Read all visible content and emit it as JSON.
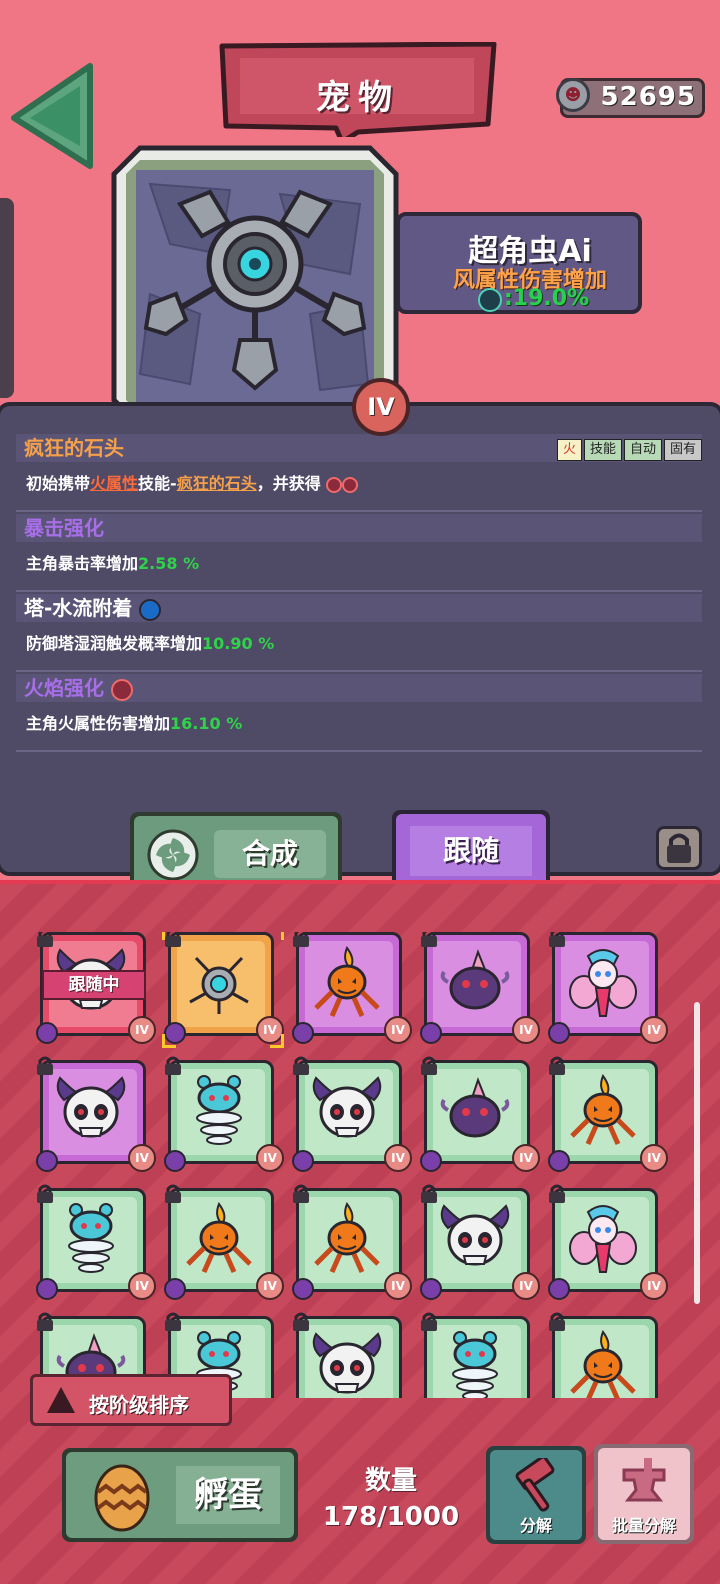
{
  "header": {
    "title": "宠物",
    "currency_value": "52695"
  },
  "pet": {
    "name": "超角虫Ai",
    "attribute": "风属性伤害增加",
    "stat_value": ":19.0%",
    "rank": "IV"
  },
  "skills": [
    {
      "title": "疯狂的石头",
      "title_color": "#f5a04a",
      "tags": [
        "火",
        "技能",
        "自动",
        "固有"
      ],
      "desc_parts": [
        "初始携带",
        "火属性",
        "技能-",
        "疯狂的石头",
        "，并获得"
      ]
    },
    {
      "title": "暴击强化",
      "title_color": "#a86ee8",
      "desc_text": "主角暴击率增加",
      "desc_value": "2.58 %"
    },
    {
      "title": "塔-水流附着",
      "title_color": "#ffffff",
      "desc_text": "防御塔湿润触发概率增加",
      "desc_value": "10.90 %"
    },
    {
      "title": "火焰强化",
      "title_color": "#a86ee8",
      "desc_text": "主角火属性伤害增加",
      "desc_value": "16.10 %"
    }
  ],
  "buttons": {
    "combine": "合成",
    "follow": "跟随",
    "sort": "按阶级排序",
    "hatch": "孵蛋",
    "decompose": "分解",
    "batch_decompose": "批量分解"
  },
  "inventory": {
    "following_label": "跟随中",
    "count_title": "数量",
    "count_value": "178/1000",
    "rank_label": "IV",
    "cards": [
      {
        "color": "red",
        "creature": "skull",
        "following": true
      },
      {
        "color": "orange",
        "creature": "robot",
        "selected": true
      },
      {
        "color": "purple",
        "creature": "pumpkin"
      },
      {
        "color": "purple",
        "creature": "blob"
      },
      {
        "color": "purple",
        "creature": "fairy"
      },
      {
        "color": "purple",
        "creature": "skull"
      },
      {
        "color": "green",
        "creature": "tornado"
      },
      {
        "color": "green",
        "creature": "skull"
      },
      {
        "color": "green",
        "creature": "blob"
      },
      {
        "color": "green",
        "creature": "pumpkin"
      },
      {
        "color": "green",
        "creature": "tornado"
      },
      {
        "color": "green",
        "creature": "pumpkin"
      },
      {
        "color": "green",
        "creature": "pumpkin"
      },
      {
        "color": "green",
        "creature": "skull"
      },
      {
        "color": "green",
        "creature": "fairy"
      },
      {
        "color": "green",
        "creature": "blob"
      },
      {
        "color": "green",
        "creature": "tornado"
      },
      {
        "color": "green",
        "creature": "skull"
      },
      {
        "color": "green",
        "creature": "tornado"
      },
      {
        "color": "green",
        "creature": "pumpkin"
      }
    ]
  },
  "colors": {
    "background": "#f07585",
    "panel": "#4f4a66",
    "accent_green": "#2ed34a",
    "accent_orange": "#ffa24a"
  }
}
